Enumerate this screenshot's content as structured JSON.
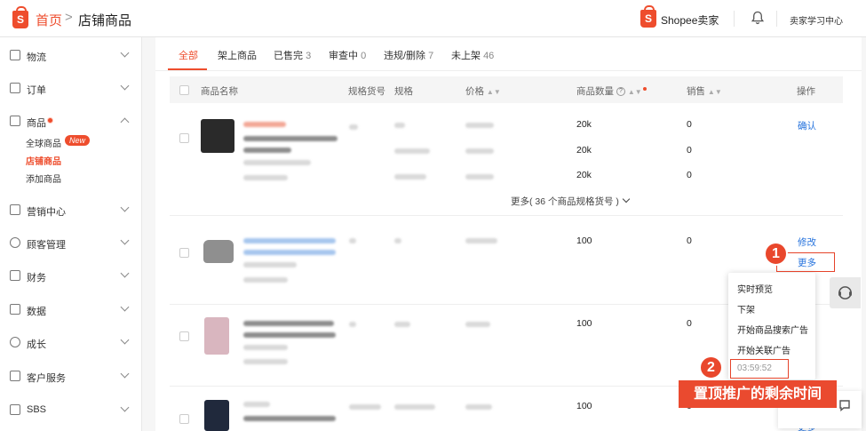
{
  "header": {
    "home": "首页",
    "separator": ">",
    "current": "店铺商品",
    "brand": "Shopee卖家",
    "learning_center": "卖家学习中心",
    "brand_color": "#ee4d2d"
  },
  "sidebar": {
    "items": [
      {
        "label": "物流",
        "icon": "truck-icon"
      },
      {
        "label": "订单",
        "icon": "clipboard-icon"
      },
      {
        "label": "商品",
        "icon": "box-icon"
      },
      {
        "label": "营销中心",
        "icon": "tag-icon"
      },
      {
        "label": "顾客管理",
        "icon": "user-icon"
      },
      {
        "label": "财务",
        "icon": "wallet-icon"
      },
      {
        "label": "数据",
        "icon": "chart-icon"
      },
      {
        "label": "成长",
        "icon": "badge-icon"
      },
      {
        "label": "客户服务",
        "icon": "headset-icon"
      },
      {
        "label": "SBS",
        "icon": "warehouse-icon"
      }
    ],
    "sub_items": [
      "全球商品",
      "店铺商品",
      "添加商品"
    ],
    "new_badge": "New"
  },
  "tabs": [
    {
      "label": "全部",
      "count": ""
    },
    {
      "label": "架上商品",
      "count": ""
    },
    {
      "label": "已售完",
      "count": "3"
    },
    {
      "label": "审查中",
      "count": "0"
    },
    {
      "label": "违规/删除",
      "count": "7"
    },
    {
      "label": "未上架",
      "count": "46"
    }
  ],
  "table": {
    "headers": {
      "name": "商品名称",
      "sku": "规格货号",
      "spec": "规格",
      "price": "价格",
      "quantity": "商品数量",
      "sales": "销售",
      "actions": "操作"
    },
    "rows": [
      {
        "qty": [
          "20k",
          "20k",
          "20k"
        ],
        "sales": [
          "0",
          "0",
          "0"
        ],
        "action": "确认"
      },
      {
        "qty": [
          "100"
        ],
        "sales": [
          "0"
        ],
        "action": "修改",
        "more": "更多"
      },
      {
        "qty": [
          "100"
        ],
        "sales": [
          "0"
        ]
      },
      {
        "qty": [
          "100"
        ],
        "sales": [
          "0"
        ],
        "more": "更多"
      }
    ],
    "more_variants": "更多( 36 个商品规格货号 )"
  },
  "popup": {
    "items": [
      "实时预览",
      "下架",
      "开始商品搜索广告",
      "开始关联广告"
    ],
    "timer": "03:59:52"
  },
  "annotations": {
    "step1": "1",
    "step2": "2",
    "callout": "置顶推广的剩余时间",
    "color": "#ea4a2f"
  }
}
